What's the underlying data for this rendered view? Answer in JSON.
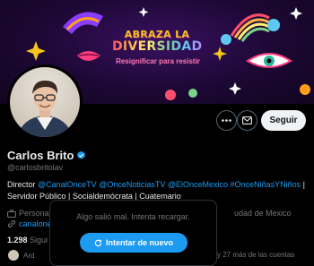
{
  "banner": {
    "title_line1": "ABRAZA LA",
    "title_line2": "DIVERSIDAD",
    "subtitle": "Resignificar para resistir"
  },
  "actions": {
    "more_icon": "ellipsis-icon",
    "message_icon": "envelope-icon",
    "follow_label": "Seguir"
  },
  "profile": {
    "name": "Carlos Brito",
    "verified_icon": "verified-badge-icon",
    "handle": "@carlosbritolav",
    "bio_prefix": "Director ",
    "bio_mentions": [
      "@CanalOnceTV",
      "@OnceNoticiasTV",
      "@ElOnceMexico",
      "#OnceNiñasYNiños"
    ],
    "bio_sep": " | ",
    "bio_line2": "Servidor Público | Socialdemócrata | Cuatemario",
    "category": "Personal",
    "location": "udad de Mexico",
    "website": "canalone",
    "following_count": "1.298",
    "following_label": "Sigui",
    "followers_preview_left": "Ard",
    "followers_preview_right": "odia) y 27 más de las cuentas"
  },
  "error": {
    "message": "Algo salió mal. Intenta recargar.",
    "retry_label": "Intentar de nuevo",
    "retry_icon": "refresh-icon"
  },
  "colors": {
    "accent": "#1d9bf0",
    "background": "#000000",
    "secondary_text": "#71767b"
  }
}
